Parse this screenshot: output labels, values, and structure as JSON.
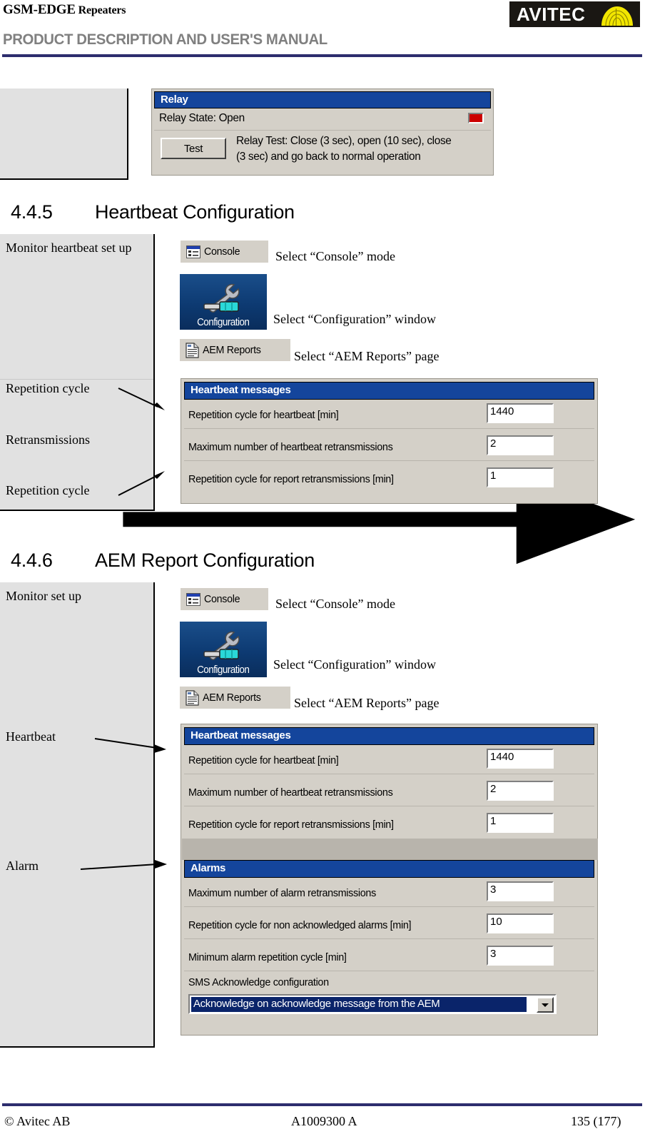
{
  "header": {
    "product_line": "GSM-EDGE Repeaters",
    "product_line_main": "GSM-EDGE",
    "product_line_sub": " Repeaters",
    "doc_title": "PRODUCT DESCRIPTION AND USER'S MANUAL",
    "logo_text": "AVITEC",
    "brand_black": "#1a1713",
    "brand_yellow": "#f2e600",
    "rule_color": "#2d2d6e"
  },
  "relay_panel": {
    "title": "Relay",
    "state_label": "Relay State: Open",
    "led_color": "#cc0000",
    "test_button": "Test",
    "test_description_line1": "Relay Test: Close (3 sec), open (10 sec), close",
    "test_description_line2": "(3 sec) and go back to normal operation"
  },
  "section_445": {
    "number": "4.4.5",
    "title": "Heartbeat Configuration",
    "left_labels": [
      "Monitor heartbeat set up",
      "Repetition cycle",
      "Retransmissions",
      "Repetition cycle"
    ],
    "steps": [
      {
        "button": "Console",
        "icon": "console-icon",
        "note": "Select “Console” mode"
      },
      {
        "button": "Configuration",
        "icon": "configuration-icon",
        "note": "Select “Configuration” window"
      },
      {
        "button": "AEM Reports",
        "icon": "aem-reports-icon",
        "note": "Select “AEM Reports” page"
      }
    ],
    "heartbeat_panel": {
      "title": "Heartbeat messages",
      "rows": [
        {
          "label": "Repetition cycle for heartbeat [min]",
          "value": "1440"
        },
        {
          "label": "Maximum number of heartbeat retransmissions",
          "value": "2"
        },
        {
          "label": "Repetition cycle for report retransmissions [min]",
          "value": "1"
        }
      ]
    }
  },
  "section_446": {
    "number": "4.4.6",
    "title": "AEM Report Configuration",
    "left_labels": [
      "Monitor set up",
      "Heartbeat",
      "Alarm"
    ],
    "steps": [
      {
        "button": "Console",
        "icon": "console-icon",
        "note": "Select “Console” mode"
      },
      {
        "button": "Configuration",
        "icon": "configuration-icon",
        "note": "Select “Configuration” window"
      },
      {
        "button": "AEM Reports",
        "icon": "aem-reports-icon",
        "note": "Select “AEM Reports” page"
      }
    ],
    "heartbeat_panel": {
      "title": "Heartbeat messages",
      "rows": [
        {
          "label": "Repetition cycle for heartbeat [min]",
          "value": "1440"
        },
        {
          "label": "Maximum number of heartbeat retransmissions",
          "value": "2"
        },
        {
          "label": "Repetition cycle for report retransmissions [min]",
          "value": "1"
        }
      ]
    },
    "alarms_panel": {
      "title": "Alarms",
      "rows": [
        {
          "label": "Maximum number of alarm retransmissions",
          "value": "3"
        },
        {
          "label": "Repetition cycle for non acknowledged alarms [min]",
          "value": "10"
        },
        {
          "label": "Minimum alarm repetition cycle [min]",
          "value": "3"
        }
      ],
      "combo_label": "SMS Acknowledge configuration",
      "combo_value": "Acknowledge on acknowledge message from the AEM"
    }
  },
  "footer": {
    "left": "© Avitec AB",
    "center": "A1009300 A",
    "right": "135 (177)"
  }
}
